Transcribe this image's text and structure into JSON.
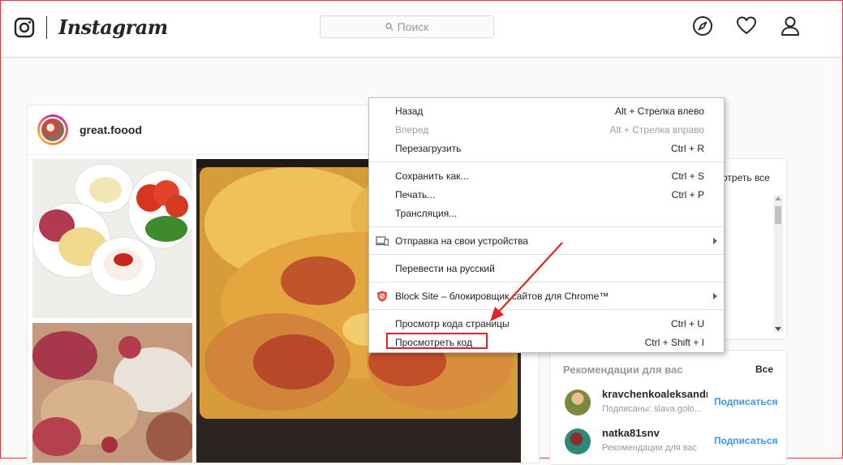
{
  "header": {
    "brand": "Instagram",
    "search_placeholder": "Поиск",
    "icons": [
      "camera-logo-icon",
      "compass-icon",
      "heart-icon",
      "profile-icon"
    ]
  },
  "post": {
    "username": "great.foood"
  },
  "suggestions_top": {
    "see_all": "отреть все"
  },
  "recommendations": {
    "title": "Рекомендации для вас",
    "all_label": "Все",
    "items": [
      {
        "name": "kravchenkoaleksandr",
        "subtitle": "Подписаны: slava.golo...",
        "button": "Подписаться"
      },
      {
        "name": "natka81snv",
        "subtitle": "Рекомендации для вас",
        "button": "Подписаться"
      }
    ]
  },
  "context_menu": {
    "items": [
      {
        "label": "Назад",
        "shortcut": "Alt + Стрелка влево",
        "disabled": false
      },
      {
        "label": "Вперед",
        "shortcut": "Alt + Стрелка вправо",
        "disabled": true
      },
      {
        "label": "Перезагрузить",
        "shortcut": "Ctrl + R",
        "disabled": false
      },
      {
        "label": "Сохранить как...",
        "shortcut": "Ctrl + S",
        "disabled": false
      },
      {
        "label": "Печать...",
        "shortcut": "Ctrl + P",
        "disabled": false
      },
      {
        "label": "Трансляция...",
        "shortcut": "",
        "disabled": false
      },
      {
        "label": "Отправка на свои устройства",
        "shortcut": "",
        "disabled": false,
        "submenu": true,
        "icon": "devices-icon"
      },
      {
        "label": "Перевести на русский",
        "shortcut": "",
        "disabled": false
      },
      {
        "label": "Block Site – блокировщик сайтов для Chrome™",
        "shortcut": "",
        "disabled": false,
        "submenu": true,
        "icon": "block-site-icon"
      },
      {
        "label": "Просмотр кода страницы",
        "shortcut": "Ctrl + U",
        "disabled": false
      },
      {
        "label": "Просмотреть код",
        "shortcut": "Ctrl + Shift + I",
        "disabled": false,
        "highlighted": true
      }
    ]
  },
  "colors": {
    "annotation_red": "#e52229",
    "follow_blue": "#3897f0",
    "border": "#dbdbdb"
  }
}
